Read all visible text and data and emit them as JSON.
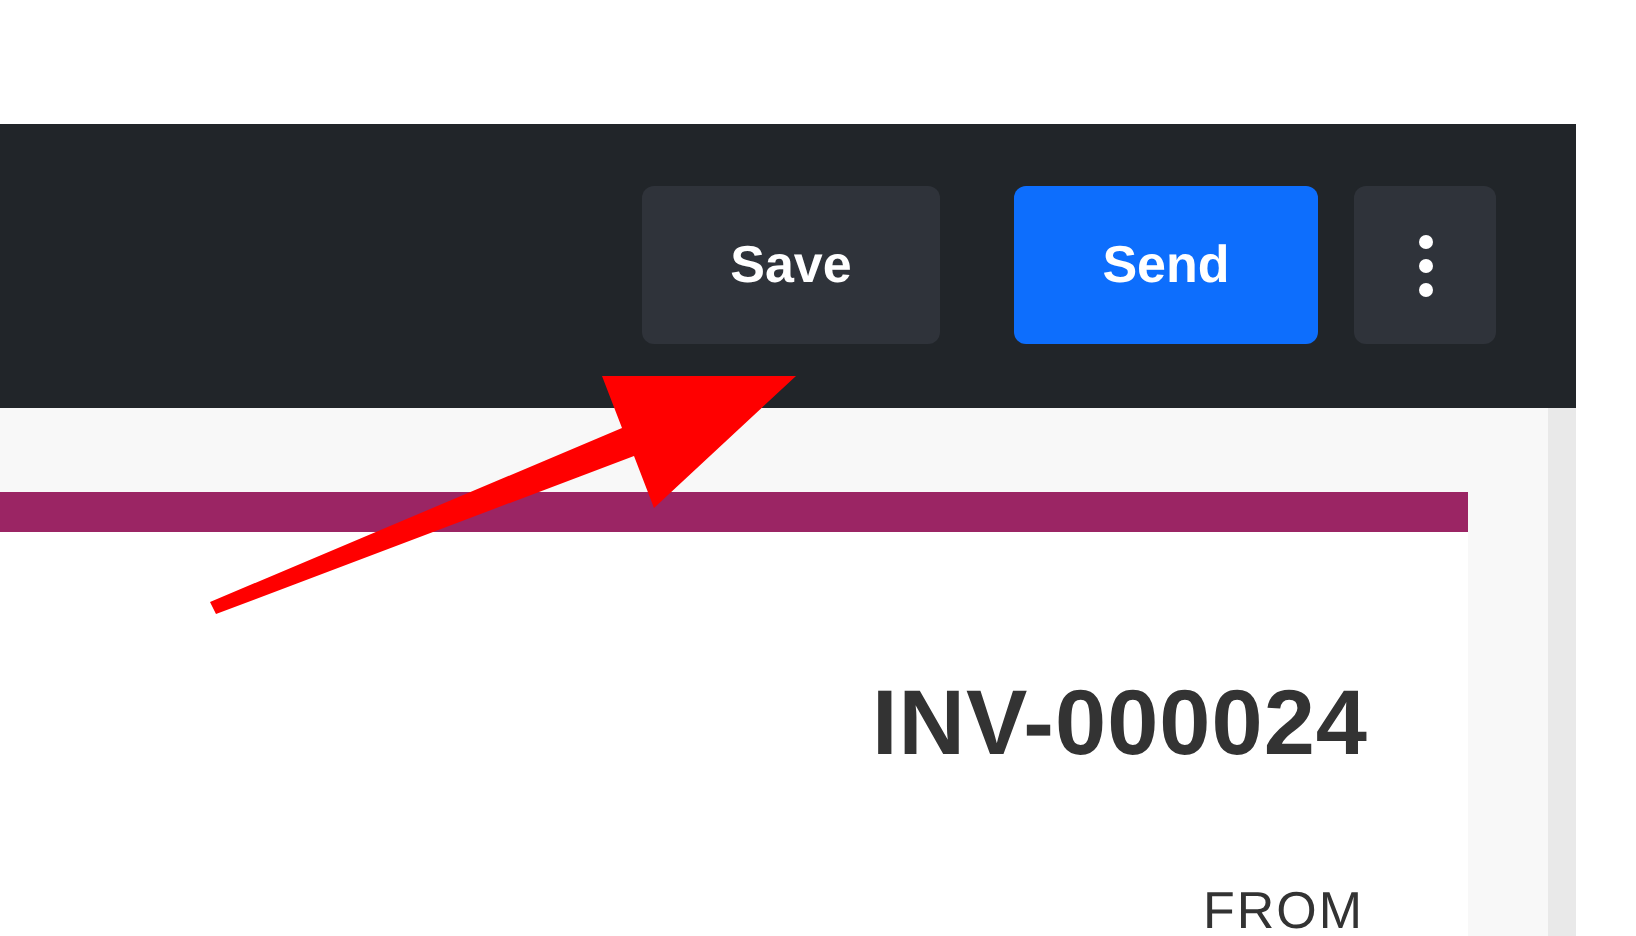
{
  "toolbar": {
    "buttons": [
      {
        "kind": "secondary",
        "label": "Save"
      },
      {
        "kind": "primary",
        "label": "Send"
      },
      {
        "kind": "more"
      }
    ]
  },
  "invoice": {
    "number": "INV-000024",
    "from_label": "FROM"
  },
  "annotation": {
    "kind": "arrow"
  }
}
